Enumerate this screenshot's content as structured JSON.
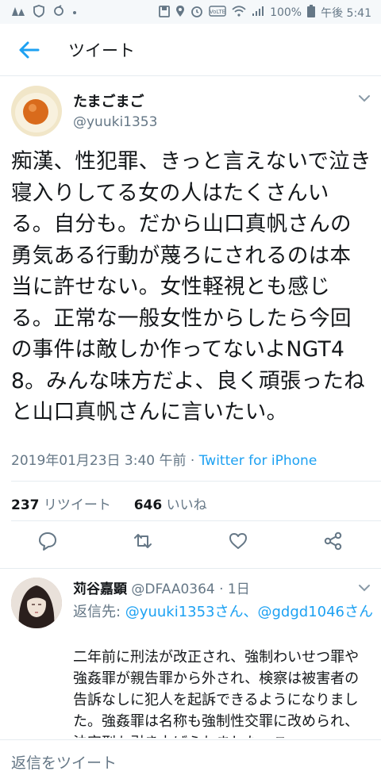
{
  "status_bar": {
    "battery": "100%",
    "time": "午後 5:41"
  },
  "header": {
    "title": "ツイート",
    "back_icon": "arrow-left-icon"
  },
  "tweet": {
    "display_name": "たまごまご",
    "handle": "@yuuki1353",
    "text": "痴漢、性犯罪、きっと言えないで泣き寝入りしてる女の人はたくさんいる。自分も。だから山口真帆さんの勇気ある行動が蔑ろにされるのは本当に許せない。女性軽視とも感じる。正常な一般女性からしたら今回の事件は敵しか作ってないよNGT48。みんな味方だよ、良く頑張ったねと山口真帆さんに言いたい。",
    "timestamp": "2019年01月23日 3:40 午前 · ",
    "source": "Twitter for iPhone",
    "retweet_count": "237",
    "retweet_label": "リツイート",
    "like_count": "646",
    "like_label": "いいね"
  },
  "actions": {
    "reply_icon": "reply-icon",
    "retweet_icon": "retweet-icon",
    "like_icon": "heart-icon",
    "share_icon": "share-icon"
  },
  "reply": {
    "display_name": "苅谷嘉顕",
    "handle_time": " @DFAA0364 · 1日",
    "reply_to_label": "返信先: ",
    "reply_to_users": "@yuuki1353さん、@gdgd1046さん",
    "text": "二年前に刑法が改正され、強制わいせつ罪や強姦罪が親告罪から外され、検察は被害者の告訴なしに犯人を起訴できるようになりました。強姦罪は名称も強制性交罪に改められ、法定刑も引き上げられました。こ"
  },
  "composer": {
    "placeholder": "返信をツイート"
  },
  "colors": {
    "accent": "#1da1f2",
    "secondary_text": "#657786",
    "divider": "#e6ecf0"
  }
}
